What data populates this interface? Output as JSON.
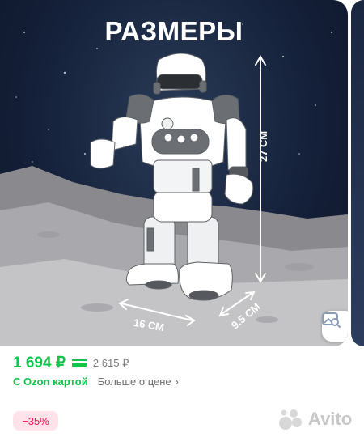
{
  "image": {
    "headline": "РАЗМЕРЫ",
    "dimensions": {
      "height": "27 СМ",
      "width": "16 СМ",
      "depth": "9.5 СМ"
    }
  },
  "price": {
    "current": "1 694 ₽",
    "old": "2 615 ₽",
    "with_ozon_card": "С Ozon картой",
    "more_about_price": "Больше о цене",
    "discount": "−35%",
    "accent_color": "#10c44c",
    "discount_color": "#f91155"
  },
  "watermark": {
    "text": "Avito"
  },
  "icons": {
    "search_photo": "image-search-icon",
    "card": "card-icon",
    "chevron": "chevron-right-icon"
  }
}
